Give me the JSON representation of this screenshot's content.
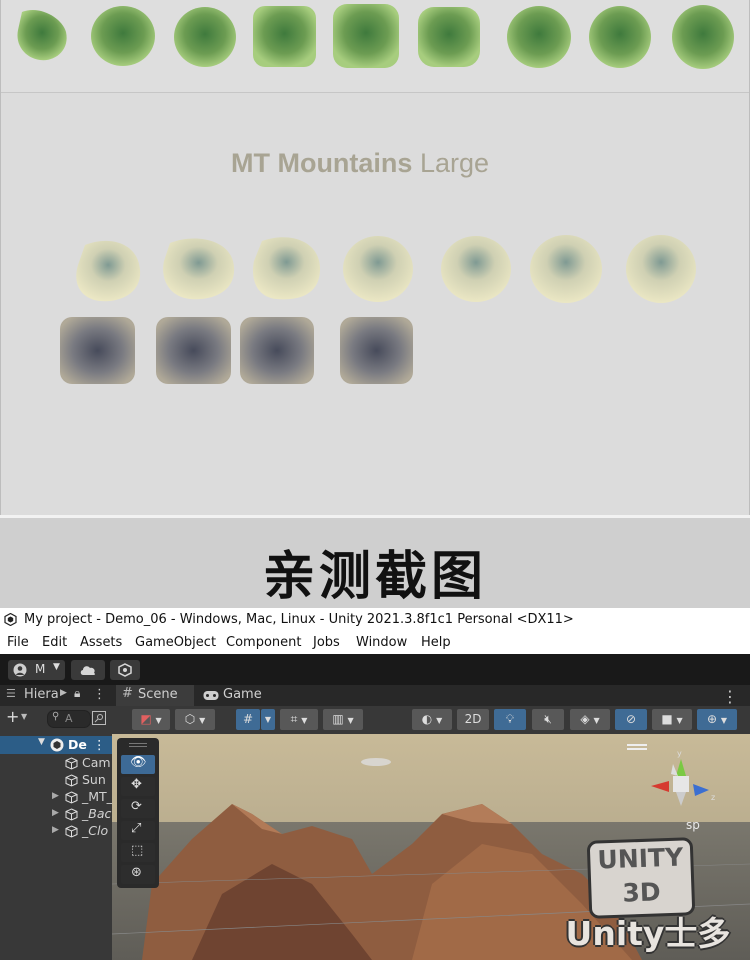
{
  "showcase": {
    "title_bold": "MT Mountains",
    "title_light": "Large"
  },
  "banner": {
    "text": "亲测截图"
  },
  "window": {
    "title": "My project - Demo_06 - Windows, Mac, Linux - Unity 2021.3.8f1c1 Personal <DX11>",
    "menu": [
      "File",
      "Edit",
      "Assets",
      "GameObject",
      "Component",
      "Jobs",
      "Window",
      "Help"
    ]
  },
  "toolbar": {
    "account_label": "M"
  },
  "hierarchy": {
    "tab_label": "Hiera",
    "search_placeholder": "A",
    "scene_label": "De",
    "items": [
      {
        "label": "Cam"
      },
      {
        "label": "Sun"
      },
      {
        "label": "_MT_"
      },
      {
        "label": "_Bac"
      },
      {
        "label": "_Clo"
      }
    ]
  },
  "scene_view": {
    "tab_scene": "Scene",
    "tab_game": "Game",
    "btn_2d": "2D",
    "persp_label": "sp"
  },
  "watermark": {
    "line1": "UNITY",
    "line2": "3D",
    "line3": "Unity士多"
  },
  "colors": {
    "selection": "#2c5d87",
    "accent_blue": "#3f6b95",
    "title_gray": "#a8a493"
  }
}
